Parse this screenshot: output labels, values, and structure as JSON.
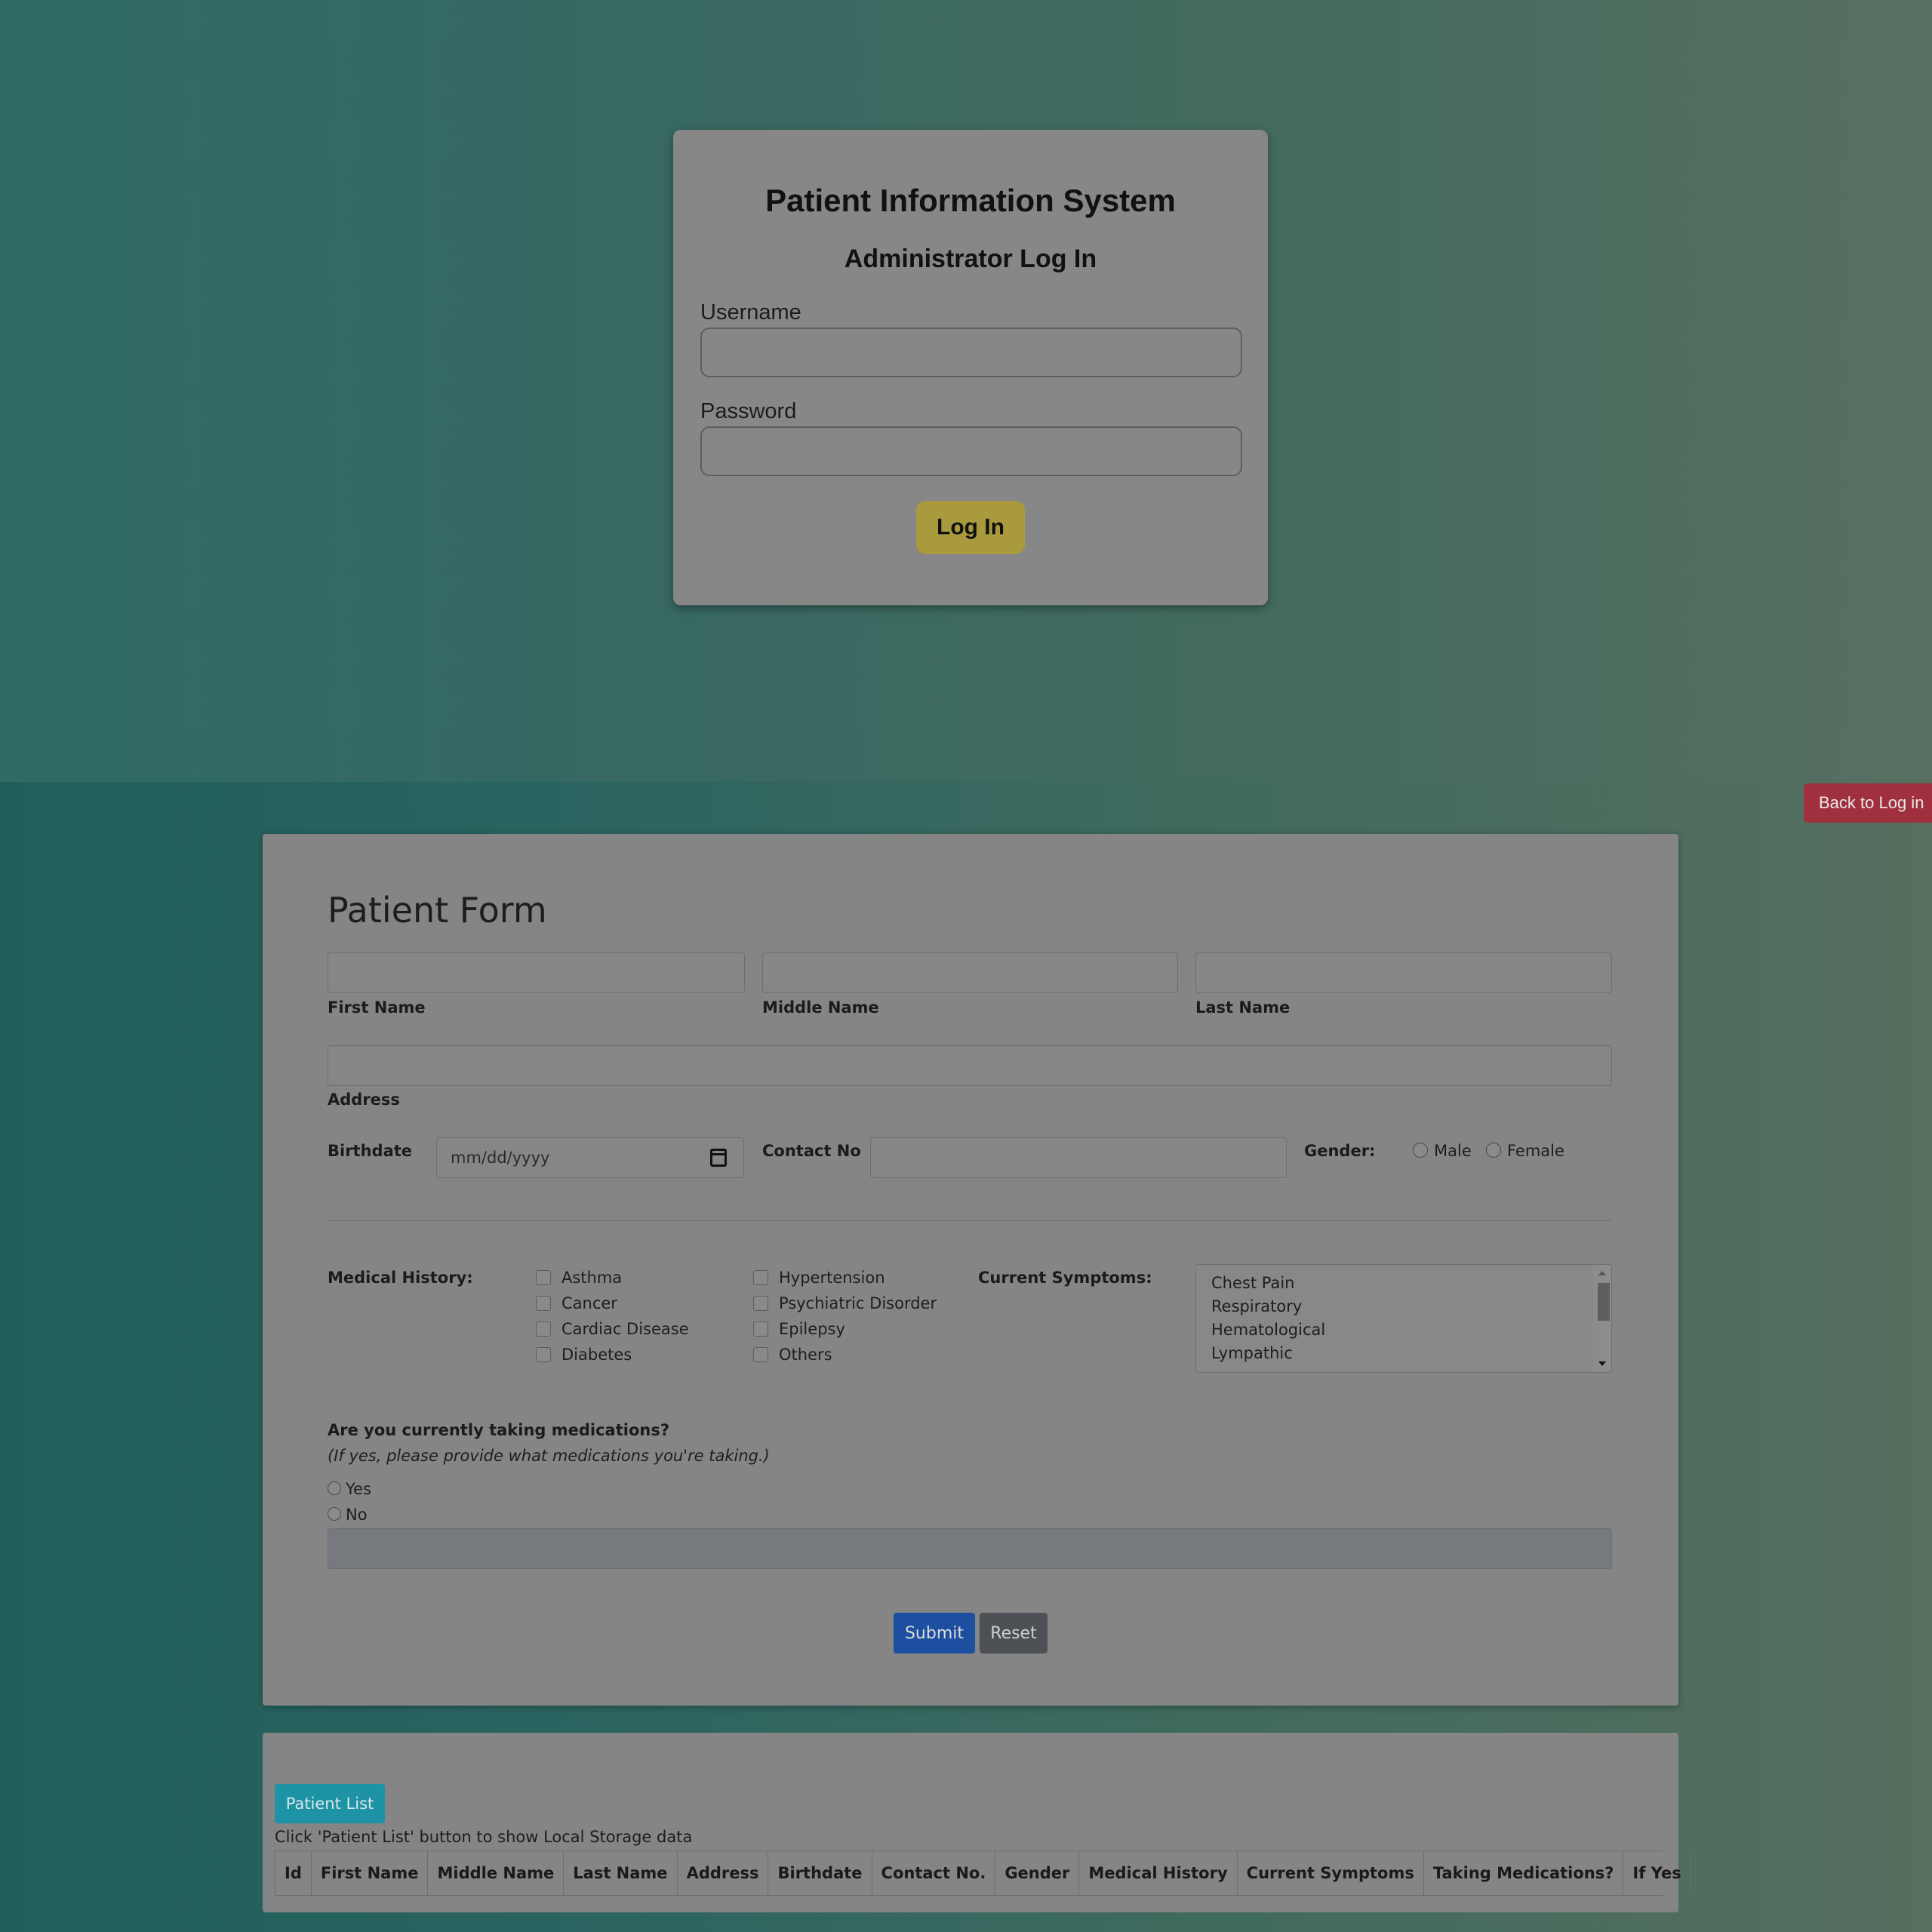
{
  "login": {
    "title": "Patient Information System",
    "subtitle": "Administrator Log In",
    "username_label": "Username",
    "username_value": "",
    "password_label": "Password",
    "password_value": "",
    "login_button": "Log In"
  },
  "back_button": "Back to Log in",
  "form": {
    "title": "Patient Form",
    "first_name_label": "First Name",
    "middle_name_label": "Middle Name",
    "last_name_label": "Last Name",
    "address_label": "Address",
    "birthdate_label": "Birthdate",
    "birthdate_placeholder": "mm/dd/yyyy",
    "contact_label": "Contact No",
    "gender_label": "Gender:",
    "gender_options": [
      "Male",
      "Female"
    ],
    "medical_history_label": "Medical History:",
    "medical_history_col1": [
      "Asthma",
      "Cancer",
      "Cardiac Disease",
      "Diabetes"
    ],
    "medical_history_col2": [
      "Hypertension",
      "Psychiatric Disorder",
      "Epilepsy",
      "Others"
    ],
    "symptoms_label": "Current Symptoms:",
    "symptoms_options": [
      "Chest Pain",
      "Respiratory",
      "Hematological",
      "Lympathic"
    ],
    "medications_question": "Are you currently taking medications?",
    "medications_hint": "(If yes, please provide what medications you're taking.)",
    "medication_options": [
      "Yes",
      "No"
    ],
    "submit_button": "Submit",
    "reset_button": "Reset"
  },
  "list": {
    "patient_list_button": "Patient List",
    "hint": "Click 'Patient List' button to show Local Storage data",
    "columns": [
      "Id",
      "First Name",
      "Middle Name",
      "Last Name",
      "Address",
      "Birthdate",
      "Contact No.",
      "Gender",
      "Medical History",
      "Current Symptoms",
      "Taking Medications?",
      "If Yes"
    ]
  }
}
